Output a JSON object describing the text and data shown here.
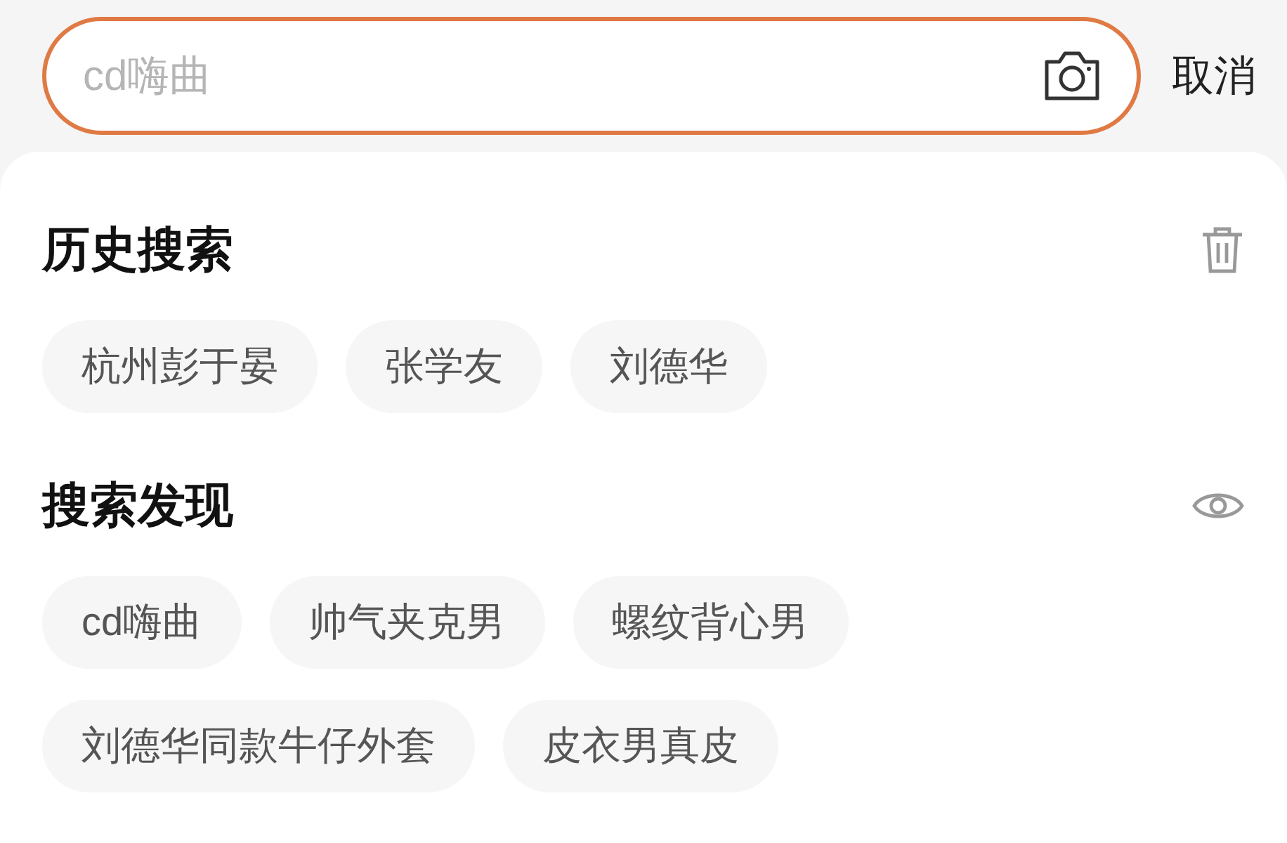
{
  "search": {
    "placeholder": "cd嗨曲"
  },
  "cancel": "取消",
  "sections": [
    {
      "title": "历史搜索",
      "kind": "history",
      "chips": [
        "杭州彭于晏",
        "张学友",
        "刘德华"
      ]
    },
    {
      "title": "搜索发现",
      "kind": "discover",
      "chips": [
        "cd嗨曲",
        "帅气夹克男",
        "螺纹背心男",
        "刘德华同款牛仔外套",
        "皮衣男真皮"
      ]
    }
  ]
}
